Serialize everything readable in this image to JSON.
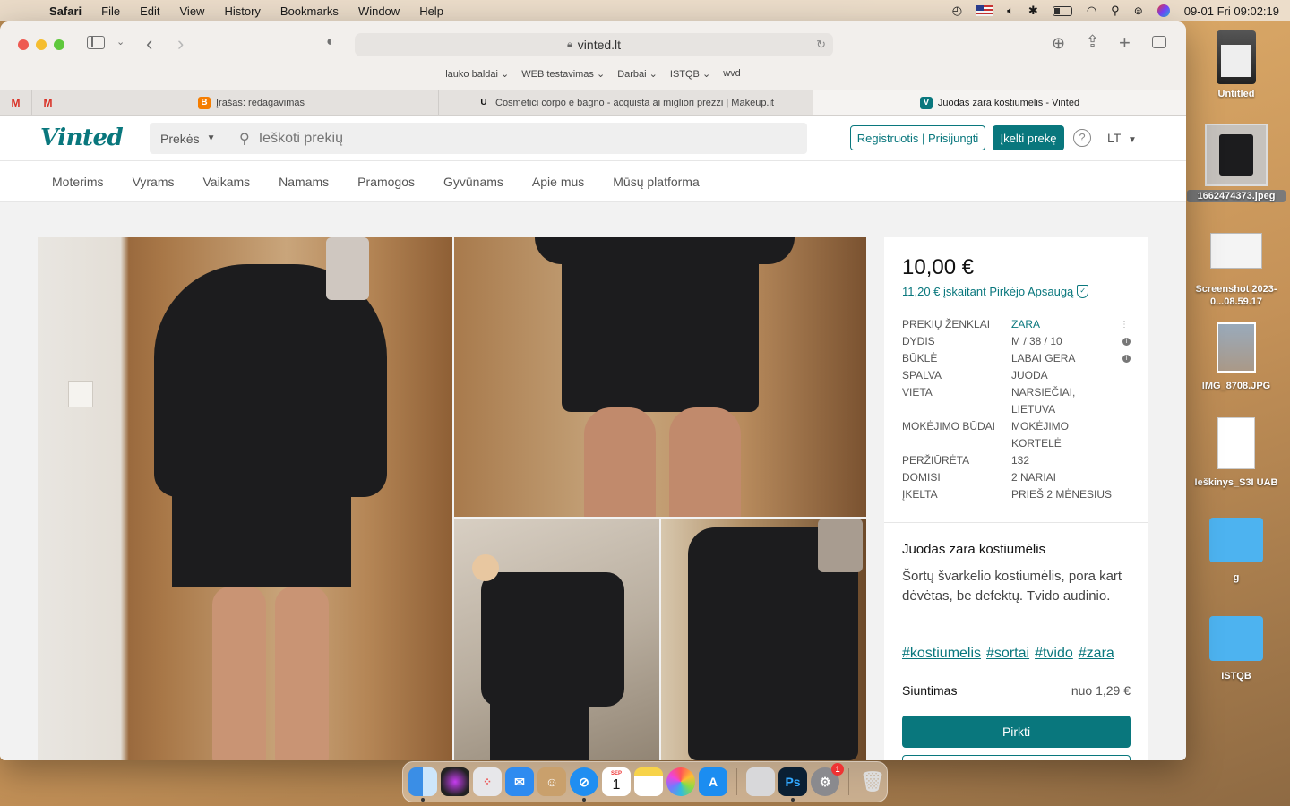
{
  "menubar": {
    "app": "Safari",
    "items": [
      "File",
      "Edit",
      "View",
      "History",
      "Bookmarks",
      "Window",
      "Help"
    ],
    "clock": "09-01 Fri  09:02:19"
  },
  "desktop": [
    {
      "label": "Untitled",
      "kind": "disk"
    },
    {
      "label": "1662474373.jpeg",
      "kind": "image"
    },
    {
      "label": "Screenshot 2023-0...08.59.17",
      "kind": "screenshot"
    },
    {
      "label": "IMG_8708.JPG",
      "kind": "photo"
    },
    {
      "label": "Ieškinys_S3I UAB",
      "kind": "document"
    },
    {
      "label": "g",
      "kind": "folder"
    },
    {
      "label": "ISTQB",
      "kind": "folder"
    }
  ],
  "safari": {
    "url": "vinted.lt",
    "bookmarks": [
      "lauko baldai",
      "WEB testavimas",
      "Darbai",
      "ISTQB",
      "wvd"
    ],
    "tabs": [
      {
        "title": "Įrašas: redagavimas",
        "favicon": "B",
        "color": "#f57d00"
      },
      {
        "title": "Cosmetici corpo e bagno - acquista ai migliori prezzi | Makeup.it",
        "favicon": "U",
        "color": "#ffffff"
      },
      {
        "title": "Juodas zara kostiumėlis - Vinted",
        "favicon": "V",
        "color": "#09777d"
      }
    ]
  },
  "vinted": {
    "logo": "Vinted",
    "search": {
      "category": "Prekės",
      "placeholder": "Ieškoti prekių"
    },
    "register_label": "Registruotis | Prisijungti",
    "upload_label": "Įkelti prekę",
    "language": "LT",
    "nav": [
      "Moterims",
      "Vyrams",
      "Vaikams",
      "Namams",
      "Pramogos",
      "Gyvūnams",
      "Apie mus",
      "Mūsų platforma"
    ],
    "item": {
      "price": "10,00 €",
      "price_protection": "11,20 € įskaitant Pirkėjo Apsaugą",
      "details": [
        {
          "key": "Prekių ženklai",
          "value": "ZARA",
          "link": true
        },
        {
          "key": "Dydis",
          "value": "M / 38 / 10",
          "info": true
        },
        {
          "key": "Būklė",
          "value": "Labai gera",
          "info": true
        },
        {
          "key": "Spalva",
          "value": "Juoda"
        },
        {
          "key": "Vieta",
          "value": "Narsiečiai, Lietuva"
        },
        {
          "key": "Mokėjimo būdai",
          "value": "Mokėjimo kortelė"
        },
        {
          "key": "Peržiūrėta",
          "value": "132"
        },
        {
          "key": "Domisi",
          "value": "2 nariai"
        },
        {
          "key": "Įkelta",
          "value": "Prieš 2 mėnesius"
        }
      ],
      "title": "Juodas zara kostiumėlis",
      "description": "Šortų švarkelio kostiumėlis, pora kart dėvėtas, be defektų. Tvido audinio.",
      "tags": [
        "#kostiumelis",
        "#sortai",
        "#tvido",
        "#zara"
      ],
      "shipping_label": "Siuntimas",
      "shipping_value": "nuo 1,29 €",
      "buy_label": "Pirkti"
    }
  },
  "dock": {
    "calendar_month": "SEP",
    "calendar_day": "1",
    "settings_badge": "1"
  }
}
